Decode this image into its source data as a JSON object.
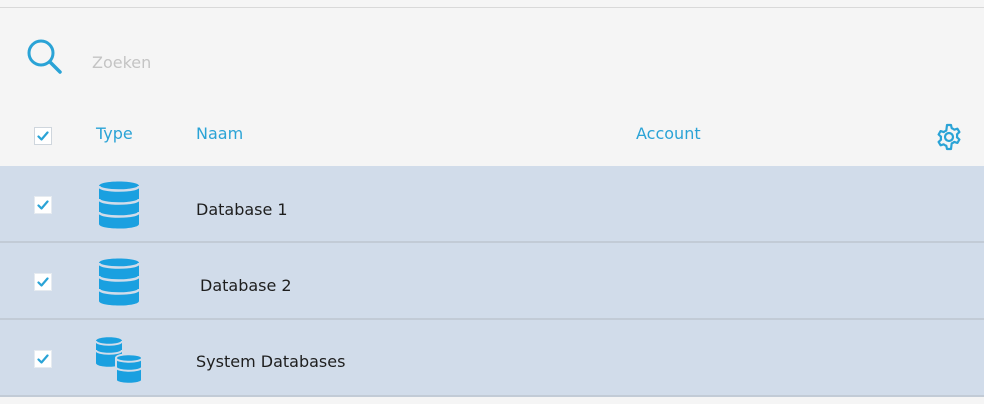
{
  "search": {
    "placeholder": "Zoeken",
    "value": ""
  },
  "table": {
    "columns": {
      "type": "Type",
      "name": "Naam",
      "account": "Account"
    },
    "header_checkbox_checked": true,
    "rows": [
      {
        "name": "Database 1",
        "icon": "database-icon",
        "checked": true,
        "account": ""
      },
      {
        "name": "Database 2",
        "icon": "database-icon",
        "checked": true,
        "account": ""
      },
      {
        "name": "System Databases",
        "icon": "multiple-databases-icon",
        "checked": true,
        "account": ""
      }
    ]
  },
  "colors": {
    "accent": "#2aa3d6",
    "row_background": "#d1dcea",
    "background": "#f5f5f5",
    "text": "#1e1e1e"
  }
}
